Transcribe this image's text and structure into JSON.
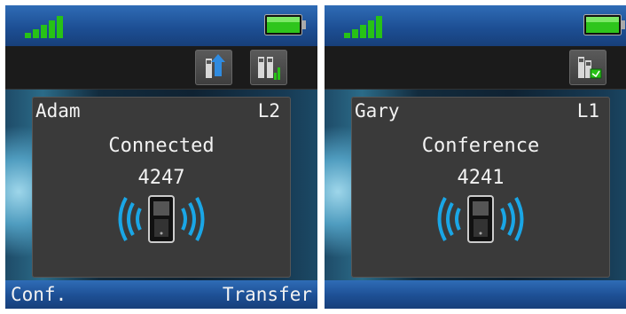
{
  "screens": [
    {
      "contact_name": "Adam",
      "line": "L2",
      "call_status": "Connected",
      "number": "4247",
      "softkey_left": "Conf.",
      "softkey_right": "Transfer",
      "toolbar_icons": [
        "call-transfer-icon",
        "call-split-icon"
      ]
    },
    {
      "contact_name": "Gary",
      "line": "L1",
      "call_status": "Conference",
      "number": "4241",
      "softkey_left": "",
      "softkey_right": "",
      "toolbar_icons": [
        "conference-merge-icon"
      ]
    }
  ],
  "colors": {
    "signal": "#27c216",
    "battery": "#2ec51c",
    "accent_blue": "#1aa6e6",
    "bar_blue": "#1d4f94"
  }
}
